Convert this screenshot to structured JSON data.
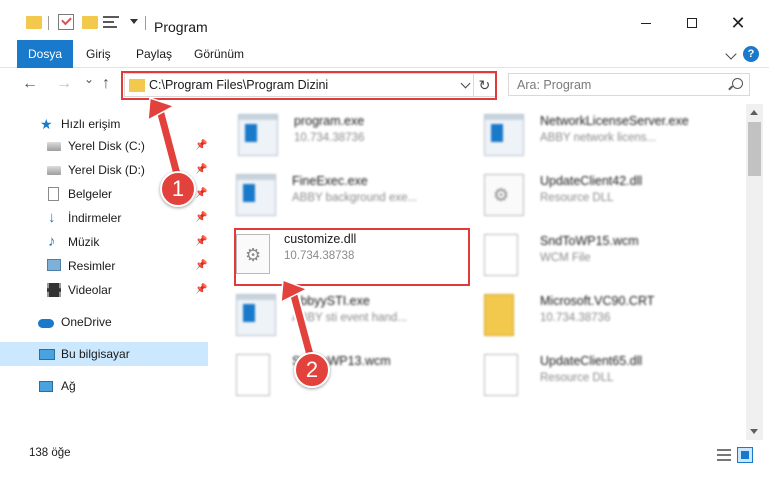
{
  "window": {
    "title": "Program",
    "controls": [
      "minimize",
      "maximize",
      "close"
    ],
    "close_glyph": "✕"
  },
  "ribbon": {
    "tabs": [
      "Dosya",
      "Giriş",
      "Paylaş",
      "Görünüm"
    ],
    "help_glyph": "?"
  },
  "address_bar": {
    "path": "C:\\Program Files\\Program Dizini",
    "refresh_glyph": "↻"
  },
  "navigation": {
    "back_glyph": "←",
    "forward_glyph": "→",
    "recent_glyph": "⌄",
    "up_glyph": "↑"
  },
  "search": {
    "placeholder": "Ara: Program"
  },
  "sidebar": {
    "items": [
      {
        "label": "Hızlı erişim",
        "icon": "star-icon",
        "pinned": false
      },
      {
        "label": "Yerel Disk (C:)",
        "icon": "disk-icon",
        "pinned": true
      },
      {
        "label": "Yerel Disk (D:)",
        "icon": "disk-icon",
        "pinned": true
      },
      {
        "label": "Belgeler",
        "icon": "documents-icon",
        "pinned": true
      },
      {
        "label": "İndirmeler",
        "icon": "download-icon",
        "pinned": true
      },
      {
        "label": "Müzik",
        "icon": "music-icon",
        "pinned": true
      },
      {
        "label": "Resimler",
        "icon": "pictures-icon",
        "pinned": true
      },
      {
        "label": "Videolar",
        "icon": "videos-icon",
        "pinned": true
      },
      {
        "label": "OneDrive",
        "icon": "onedrive-icon",
        "pinned": false
      },
      {
        "label": "Bu bilgisayar",
        "icon": "this-pc-icon",
        "pinned": false,
        "selected": true
      },
      {
        "label": "Ağ",
        "icon": "network-icon",
        "pinned": false
      }
    ],
    "pin_glyph": "📌"
  },
  "files": [
    {
      "name": "program.exe",
      "detail": "10.734.38736",
      "type": "exe",
      "blurred": true
    },
    {
      "name": "NetworkLicenseServer.exe",
      "detail": "ABBY network licens...",
      "type": "exe",
      "blurred": true
    },
    {
      "name": "FineExec.exe",
      "detail": "ABBY background exe...",
      "type": "exe",
      "blurred": true
    },
    {
      "name": "UpdateClient42.dll",
      "detail": "Resource DLL",
      "type": "dll",
      "blurred": true
    },
    {
      "name": "customize.dll",
      "detail": "10.734.38738",
      "type": "dll",
      "blurred": false,
      "highlighted": true
    },
    {
      "name": "SndToWP15.wcm",
      "detail": "WCM File",
      "type": "plain",
      "blurred": true
    },
    {
      "name": "AbbyySTI.exe",
      "detail": "ABBY sti event hand...",
      "type": "exe",
      "blurred": true
    },
    {
      "name": "Microsoft.VC90.CRT",
      "detail": "10.734.38736",
      "type": "folder",
      "blurred": true
    },
    {
      "name": "SndToWP13.wcm",
      "detail": "",
      "type": "plain",
      "blurred": true
    },
    {
      "name": "UpdateClient65.dll",
      "detail": "Resource DLL",
      "type": "dll",
      "blurred": true
    }
  ],
  "callouts": {
    "step1": "1",
    "step2": "2",
    "color": "#e2413c"
  },
  "status_bar": {
    "item_count": "138 öğe"
  },
  "colors": {
    "accent": "#1979ca",
    "highlight": "#e03b3b",
    "selection": "#cce8ff"
  }
}
